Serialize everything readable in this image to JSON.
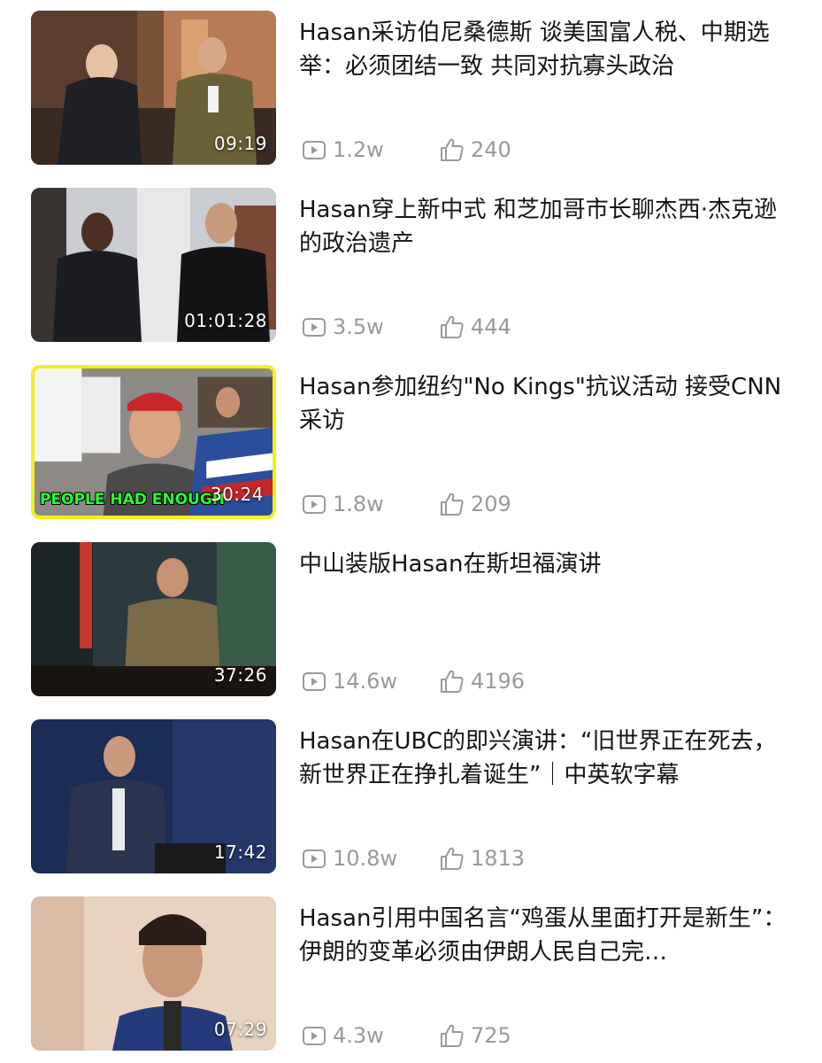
{
  "videos": [
    {
      "title": "Hasan采访伯尼桑德斯 谈美国富人税、中期选举：必须团结一致 共同对抗寡头政治",
      "duration": "09:19",
      "views": "1.2w",
      "likes": "240"
    },
    {
      "title": "Hasan穿上新中式 和芝加哥市长聊杰西·杰克逊的政治遗产",
      "duration": "01:01:28",
      "views": "3.5w",
      "likes": "444"
    },
    {
      "title": "Hasan参加纽约\"No Kings\"抗议活动 接受CNN采访",
      "duration": "30:24",
      "thumb_banner": "PEOPLE HAD ENOUGH",
      "views": "1.8w",
      "likes": "209"
    },
    {
      "title": "中山装版Hasan在斯坦福演讲",
      "duration": "37:26",
      "views": "14.6w",
      "likes": "4196"
    },
    {
      "title": "Hasan在UBC的即兴演讲：“旧世界正在死去，新世界正在挣扎着诞生”｜中英软字幕",
      "duration": "17:42",
      "views": "10.8w",
      "likes": "1813"
    },
    {
      "title": "Hasan引用中国名言“鸡蛋从里面打开是新生”：伊朗的变革必须由伊朗人民自己完…",
      "duration": "07:29",
      "views": "4.3w",
      "likes": "725"
    }
  ],
  "icons": {
    "views": "play-count-icon",
    "likes": "thumbs-up-icon"
  },
  "colors": {
    "title": "#141414",
    "meta": "#9a9a9a",
    "highlight_border": "#f2ef1a",
    "banner_text": "#27ff2e"
  }
}
